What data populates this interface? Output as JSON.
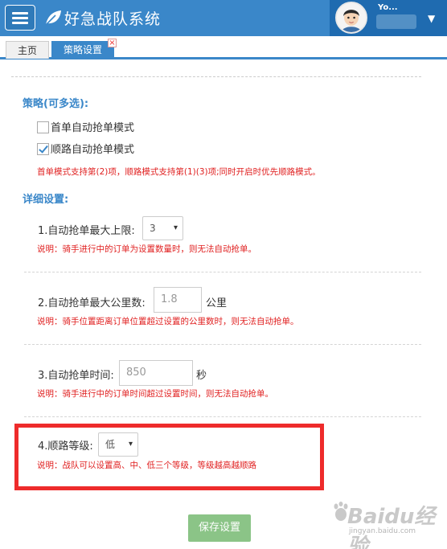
{
  "app": {
    "title": "好急战队系统",
    "username": "Yo..."
  },
  "tabs": [
    {
      "label": "主页"
    },
    {
      "label": "策略设置",
      "close": "×"
    }
  ],
  "strategy": {
    "title": "策略(可多选):",
    "options": [
      {
        "label": "首单自动抢单模式",
        "checked": false
      },
      {
        "label": "顺路自动抢单模式",
        "checked": true
      }
    ],
    "note": "首单模式支持第(2)项，顺路模式支持第(1)(3)项;同时开启时优先顺路模式。"
  },
  "detail": {
    "title": "详细设置:",
    "items": [
      {
        "label": "1.自动抢单最大上限:",
        "value": "3",
        "note": "说明：骑手进行中的订单为设置数量时，则无法自动抢单。"
      },
      {
        "label": "2.自动抢单最大公里数:",
        "value": "1.8",
        "unit": "公里",
        "note": "说明：骑手位置距离订单位置超过设置的公里数时，则无法自动抢单。"
      },
      {
        "label": "3.自动抢单时间:",
        "value": "850",
        "unit": "秒",
        "note": "说明：骑手进行中的订单时间超过设置时间，则无法自动抢单。"
      },
      {
        "label": "4.顺路等级:",
        "value": "低",
        "note": "说明：战队可以设置高、中、低三个等级，等级越高越顺路"
      }
    ]
  },
  "save_label": "保存设置",
  "watermark": {
    "main": "Baidu经验",
    "sub": "jingyan.baidu.com"
  },
  "colors": {
    "header": "#3a87c9",
    "accent": "#3a87c9",
    "note": "#e02020",
    "highlight": "#ee2b2b",
    "save": "#8bc487"
  }
}
